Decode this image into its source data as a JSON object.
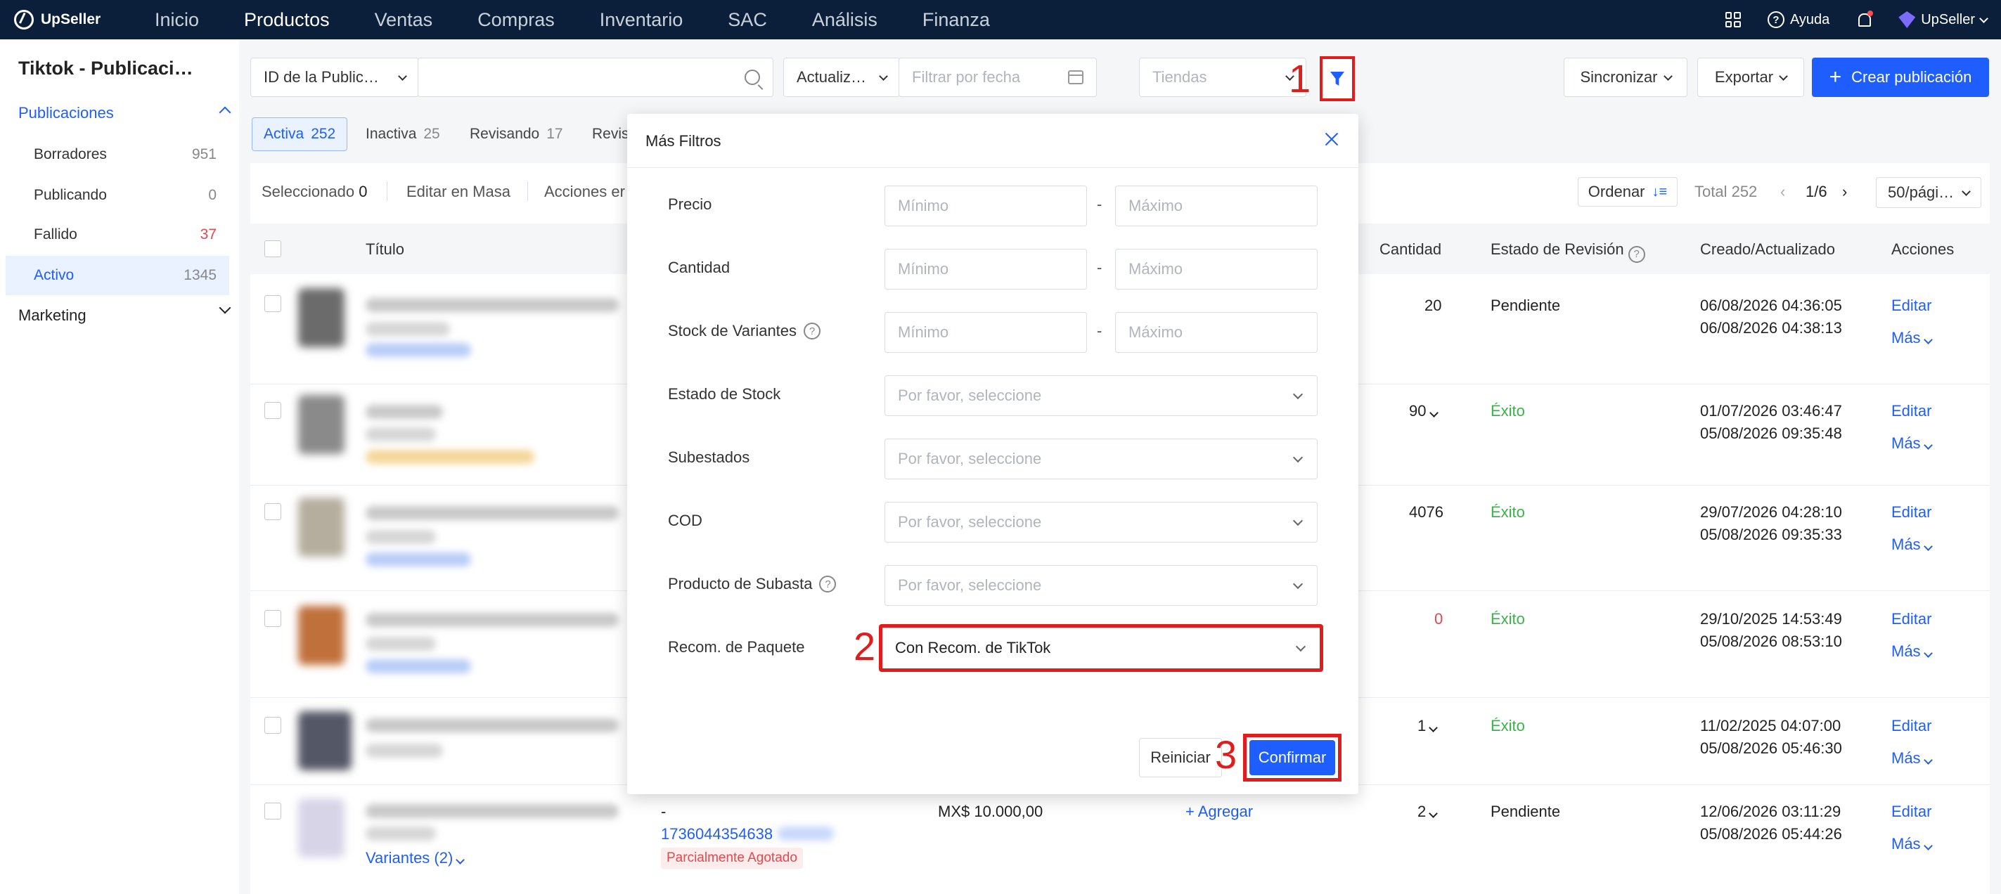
{
  "topnav": {
    "brand": "UpSeller",
    "items": [
      "Inicio",
      "Productos",
      "Ventas",
      "Compras",
      "Inventario",
      "SAC",
      "Análisis",
      "Finanza"
    ],
    "help": "Ayuda",
    "account": "UpSeller"
  },
  "sidebar": {
    "title": "Tiktok - Publicaci…",
    "group_publicaciones": "Publicaciones",
    "items": [
      {
        "label": "Borradores",
        "count": "951"
      },
      {
        "label": "Publicando",
        "count": "0"
      },
      {
        "label": "Fallido",
        "count": "37"
      },
      {
        "label": "Activo",
        "count": "1345"
      }
    ],
    "group_marketing": "Marketing"
  },
  "filters": {
    "id_select": "ID de la Public…",
    "date_select": "Actualiz…",
    "date_placeholder": "Filtrar por fecha",
    "stores_placeholder": "Tiendas",
    "sync": "Sincronizar",
    "export": "Exportar",
    "create": "Crear publicación"
  },
  "steps": {
    "one": "1",
    "two": "2",
    "three": "3"
  },
  "tabs": [
    {
      "label": "Activa",
      "count": "252"
    },
    {
      "label": "Inactiva",
      "count": "25"
    },
    {
      "label": "Revisando",
      "count": "17"
    },
    {
      "label": "Revis",
      "count": ""
    }
  ],
  "toolbar": {
    "selected_label": "Seleccionado",
    "selected_count": "0",
    "bulk_edit": "Editar en Masa",
    "actions": "Acciones er",
    "sort": "Ordenar",
    "total": "Total 252",
    "page": "1/6",
    "per_page": "50/pági…"
  },
  "table": {
    "headers": {
      "title": "Título",
      "quantity": "Cantidad",
      "review": "Estado de Revisión",
      "dates": "Creado/Actualizado",
      "actions": "Acciones"
    },
    "rows": [
      {
        "qty": "20",
        "review": "Pendiente",
        "created": "06/08/2026 04:36:05",
        "updated": "06/08/2026 04:38:13",
        "edit": "Editar",
        "more": "Más"
      },
      {
        "qty": "90",
        "review": "Éxito",
        "created": "01/07/2026 03:46:47",
        "updated": "05/08/2026 09:35:48",
        "edit": "Editar",
        "more": "Más"
      },
      {
        "qty": "4076",
        "review": "Éxito",
        "created": "29/07/2026 04:28:10",
        "updated": "05/08/2026 09:35:33",
        "edit": "Editar",
        "more": "Más"
      },
      {
        "qty": "0",
        "review": "Éxito",
        "created": "29/10/2025 14:53:49",
        "updated": "05/08/2026 08:53:10",
        "edit": "Editar",
        "more": "Más"
      },
      {
        "qty": "1",
        "review": "Éxito",
        "created": "11/02/2025 04:07:00",
        "updated": "05/08/2026 05:46:30",
        "edit": "Editar",
        "more": "Más"
      },
      {
        "qty": "2",
        "review": "Pendiente",
        "created": "12/06/2026 03:11:29",
        "updated": "05/08/2026 05:44:26",
        "edit": "Editar",
        "more": "Más",
        "variants": "Variantes (2)",
        "sku_dash": "-",
        "sku_id": "1736044354638",
        "stock_badge": "Parcialmente Agotado",
        "price": "MX$ 10.000,00",
        "add": "+ Agregar"
      }
    ]
  },
  "modal": {
    "title": "Más Filtros",
    "min_placeholder": "Mínimo",
    "max_placeholder": "Máximo",
    "select_placeholder": "Por favor, seleccione",
    "labels": {
      "price": "Precio",
      "quantity": "Cantidad",
      "variant_stock": "Stock de Variantes",
      "stock_state": "Estado de Stock",
      "substates": "Subestados",
      "cod": "COD",
      "auction": "Producto de Subasta",
      "package_rec": "Recom. de Paquete"
    },
    "package_rec_value": "Con Recom. de TikTok",
    "reset": "Reiniciar",
    "confirm": "Confirmar"
  },
  "colors": {
    "primary": "#1e5eff",
    "nav_bg": "#0b1f3a",
    "highlight": "#e21b1b",
    "success": "#3bb34a",
    "danger": "#e5484d"
  }
}
